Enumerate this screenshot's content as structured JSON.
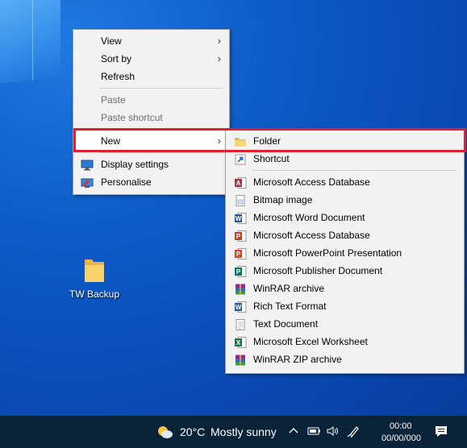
{
  "desktop": {
    "icon_label": "TW Backup"
  },
  "context_menu": {
    "items": [
      {
        "label": "View",
        "has_submenu": true,
        "enabled": true
      },
      {
        "label": "Sort by",
        "has_submenu": true,
        "enabled": true
      },
      {
        "label": "Refresh",
        "has_submenu": false,
        "enabled": true
      },
      {
        "label": "Paste",
        "has_submenu": false,
        "enabled": false
      },
      {
        "label": "Paste shortcut",
        "has_submenu": false,
        "enabled": false
      },
      {
        "label": "New",
        "has_submenu": true,
        "enabled": true
      },
      {
        "label": "Display settings",
        "has_submenu": false,
        "enabled": true,
        "icon": "display-icon"
      },
      {
        "label": "Personalise",
        "has_submenu": false,
        "enabled": true,
        "icon": "personalise-icon"
      }
    ]
  },
  "new_submenu": {
    "items": [
      {
        "label": "Folder",
        "icon": "folder-icon"
      },
      {
        "label": "Shortcut",
        "icon": "shortcut-icon"
      },
      {
        "label": "Microsoft Access Database",
        "icon": "access-icon"
      },
      {
        "label": "Bitmap image",
        "icon": "bitmap-icon"
      },
      {
        "label": "Microsoft Word Document",
        "icon": "word-icon"
      },
      {
        "label": "Microsoft Access Database",
        "icon": "access-icon"
      },
      {
        "label": "Microsoft PowerPoint Presentation",
        "icon": "powerpoint-icon"
      },
      {
        "label": "Microsoft Publisher Document",
        "icon": "publisher-icon"
      },
      {
        "label": "WinRAR archive",
        "icon": "winrar-icon"
      },
      {
        "label": "Rich Text Format",
        "icon": "rtf-icon"
      },
      {
        "label": "Text Document",
        "icon": "text-document-icon"
      },
      {
        "label": "Microsoft Excel Worksheet",
        "icon": "excel-icon"
      },
      {
        "label": "WinRAR ZIP archive",
        "icon": "winrar-zip-icon"
      }
    ]
  },
  "taskbar": {
    "weather_temp": "20°C",
    "weather_text": "Mostly sunny",
    "time": "00:00",
    "date": "00/00/000"
  },
  "colors": {
    "highlight_border": "#e1202f",
    "menu_bg": "#f2f2f2",
    "taskbar_bg": "#0b2338",
    "desktop_bg": "#0a4ab4"
  }
}
